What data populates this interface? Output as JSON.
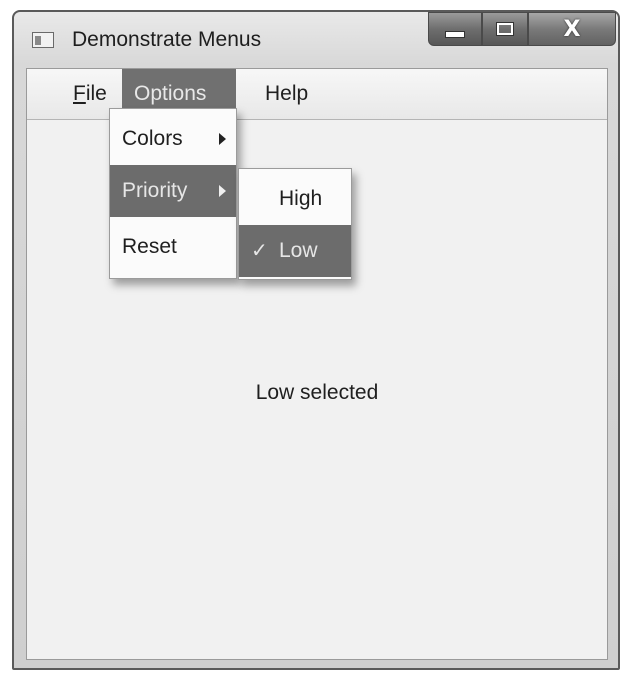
{
  "window": {
    "title": "Demonstrate Menus",
    "close_glyph": "X"
  },
  "menubar": {
    "items": [
      {
        "label_first": "F",
        "label_rest": "ile"
      },
      {
        "label": "Options"
      },
      {
        "label": "Help"
      }
    ]
  },
  "options_menu": {
    "items": [
      {
        "label": "Colors",
        "has_submenu": true
      },
      {
        "label": "Priority",
        "has_submenu": true,
        "highlighted": true
      },
      {
        "label": "Reset"
      }
    ]
  },
  "priority_submenu": {
    "items": [
      {
        "label": "High",
        "checked": false
      },
      {
        "label": "Low",
        "checked": true,
        "check_glyph": "✓",
        "highlighted": true
      }
    ]
  },
  "content": {
    "status": "Low selected"
  },
  "colors": {
    "highlight": "#6c6c6c",
    "menu_bg": "#fbfbfb",
    "client_bg": "#f1f1f1"
  },
  "icons": [
    "app-icon",
    "minimize-icon",
    "maximize-icon",
    "close-icon",
    "submenu-arrow-icon",
    "check-icon"
  ]
}
